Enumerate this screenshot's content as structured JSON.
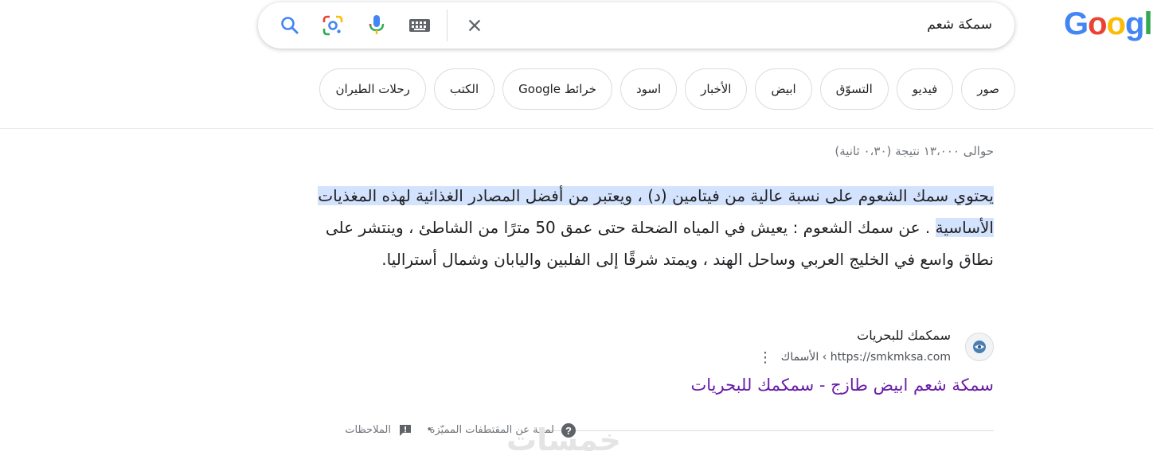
{
  "logo": {
    "text": "Google"
  },
  "search": {
    "query": "سمكة شعم"
  },
  "chips": [
    "صور",
    "فيديو",
    "التسوّق",
    "ابيض",
    "الأخبار",
    "اسود",
    "خرائط Google",
    "الكتب",
    "رحلات الطيران"
  ],
  "stats": "حوالى ١٣،٠٠٠ نتيجة (٠،٣٠ ثانية)",
  "snippet": {
    "highlighted": "يحتوي سمك الشعوم على نسبة عالية من فيتامين (د) ، ويعتبر من أفضل المصادر الغذائية لهذه المغذيات الأساسية",
    "rest": " . عن سمك الشعوم : يعيش في المياه الضحلة حتى عمق 50 مترًا من الشاطئ ، وينتشر على نطاق واسع في الخليج العربي وساحل الهند ، ويمتد شرقًا إلى الفلبين واليابان وشمال أستراليا."
  },
  "result": {
    "site_name": "سمكمك للبحريات",
    "url": "https://smkmksa.com",
    "breadcrumb": "› الأسماك",
    "title": "سمكة شعم ابيض طازج - سمكمك للبحريات"
  },
  "footer": {
    "about_label": "لمحة عن المقتطفات المميّزة",
    "separator": "•",
    "feedback_label": "الملاحظات"
  },
  "watermark": "خمسات",
  "colors": {
    "logo_blue": "#4285f4",
    "logo_red": "#ea4335",
    "logo_yellow": "#fbbc05",
    "logo_green": "#34a853",
    "highlight": "#d3e3fd",
    "visited_link": "#681da8"
  }
}
